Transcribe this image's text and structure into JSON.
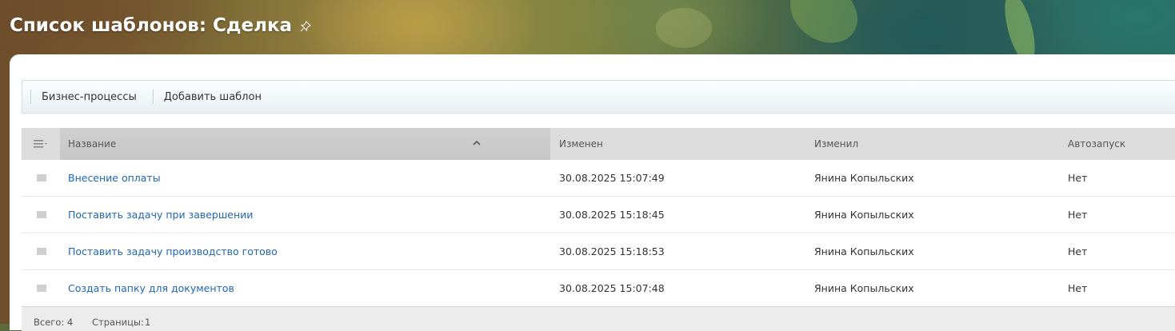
{
  "page": {
    "title": "Список шаблонов: Сделка"
  },
  "toolbar": {
    "business_processes_label": "Бизнес-процессы",
    "add_template_label": "Добавить шаблон"
  },
  "grid": {
    "columns": {
      "name": "Название",
      "changed": "Изменен",
      "changed_by": "Изменил",
      "autostart": "Автозапуск"
    },
    "rows": [
      {
        "name": "Внесение оплаты",
        "changed": "30.08.2025 15:07:49",
        "changed_by": "Янина Копыльских",
        "autostart": "Нет"
      },
      {
        "name": "Поставить задачу при завершении",
        "changed": "30.08.2025 15:18:45",
        "changed_by": "Янина Копыльских",
        "autostart": "Нет"
      },
      {
        "name": "Поставить задачу производство готово",
        "changed": "30.08.2025 15:18:53",
        "changed_by": "Янина Копыльских",
        "autostart": "Нет"
      },
      {
        "name": "Создать папку для документов",
        "changed": "30.08.2025 15:07:48",
        "changed_by": "Янина Копыльских",
        "autostart": "Нет"
      }
    ],
    "footer": {
      "total_label": "Всего: 4",
      "pages_label": "Страницы:",
      "page_number": "1"
    }
  },
  "colors": {
    "link": "#2067b0",
    "header_bg": "#dcdcdc",
    "sorted_column_bg": "#c9c9c9"
  },
  "icons": {
    "pin": "pin-icon",
    "column_menu": "column-menu-icon",
    "sort": "sort-ascending-icon"
  }
}
